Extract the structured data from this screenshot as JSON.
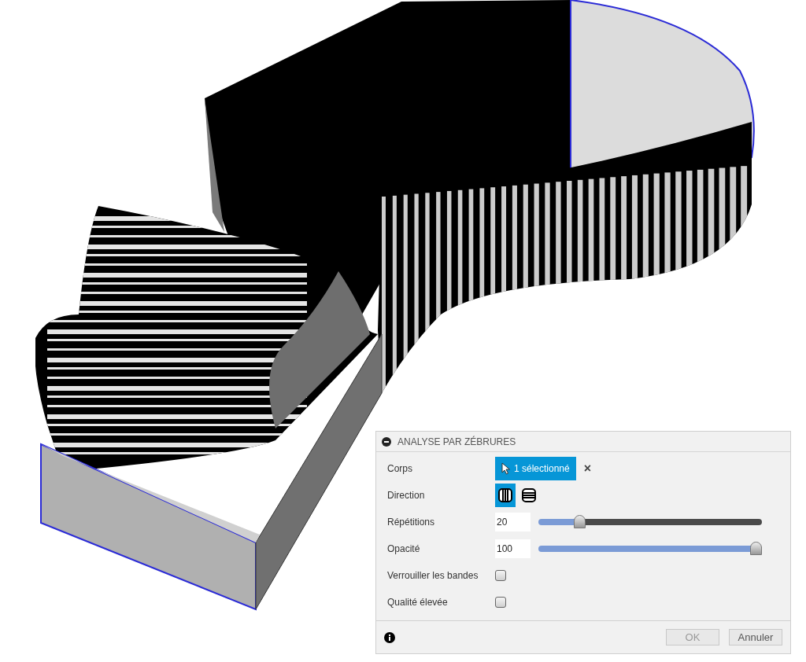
{
  "panel": {
    "title": "ANALYSE PAR ZÉBRURES",
    "expanded": true,
    "body": {
      "label": "Corps",
      "selection": "1 sélectionné",
      "clear": "×"
    },
    "direction": {
      "label": "Direction",
      "options": [
        {
          "kind": "vertical",
          "selected": true
        },
        {
          "kind": "horizontal",
          "selected": false
        }
      ]
    },
    "repetitions": {
      "label": "Répétitions",
      "value": "20",
      "level": 0.19
    },
    "opacity": {
      "label": "Opacité",
      "value": "100",
      "level": 1
    },
    "checkboxes": [
      {
        "label": "Verrouiller les bandes",
        "checked": false
      },
      {
        "label": "Qualité élevée",
        "checked": false
      }
    ],
    "buttons": [
      "OK",
      "Annuler"
    ]
  }
}
